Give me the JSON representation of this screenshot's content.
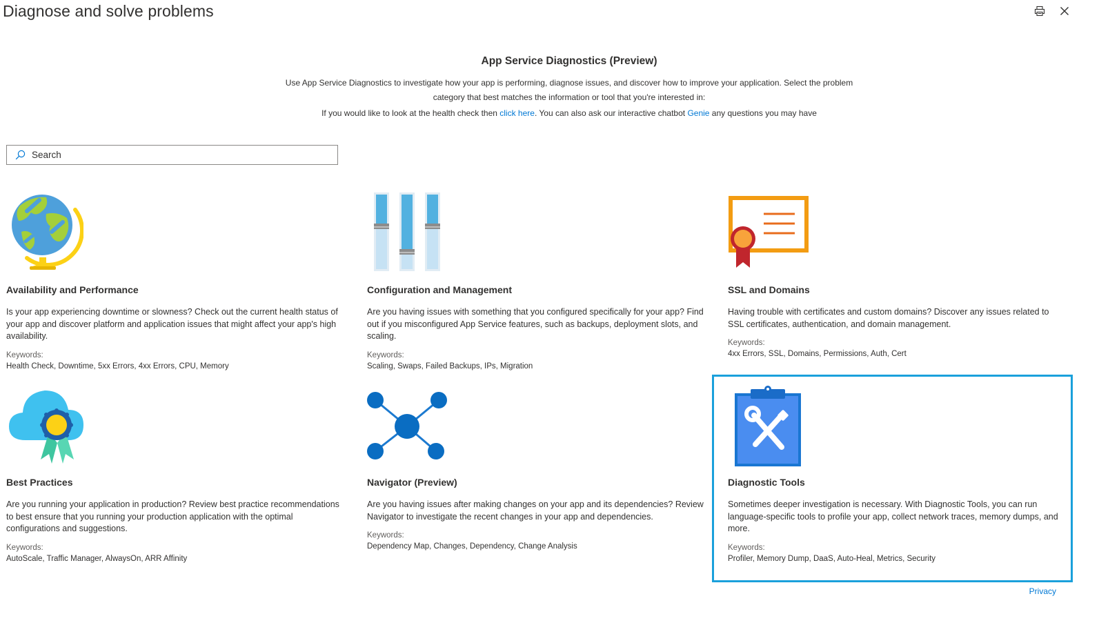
{
  "page": {
    "title": "Diagnose and solve problems"
  },
  "toolbar": {
    "print_icon": "print-icon",
    "close_icon": "close-icon"
  },
  "header": {
    "title": "App Service Diagnostics (Preview)",
    "description": "Use App Service Diagnostics to investigate how your app is performing, diagnose issues, and discover how to improve your application. Select the problem category that best matches the information or tool that you're interested in:",
    "health_prefix": "If you would like to look at the health check then ",
    "health_link": "click here",
    "health_middle": ". You can also ask our interactive chatbot ",
    "genie_link": "Genie",
    "health_suffix": " any questions you may have"
  },
  "search": {
    "placeholder": "Search",
    "value": ""
  },
  "cards": [
    {
      "title": "Availability and Performance",
      "description": "Is your app experiencing downtime or slowness? Check out the current health status of your app and discover platform and application issues that might affect your app's high availability.",
      "keywords_label": "Keywords:",
      "keywords": "Health Check, Downtime, 5xx Errors, 4xx Errors, CPU, Memory",
      "icon": "globe-icon"
    },
    {
      "title": "Configuration and Management",
      "description": "Are you having issues with something that you configured specifically for your app? Find out if you misconfigured App Service features, such as backups, deployment slots, and scaling.",
      "keywords_label": "Keywords:",
      "keywords": "Scaling, Swaps, Failed Backups, IPs, Migration",
      "icon": "sliders-icon"
    },
    {
      "title": "SSL and Domains",
      "description": "Having trouble with certificates and custom domains? Discover any issues related to SSL certificates, authentication, and domain management.",
      "keywords_label": "Keywords:",
      "keywords": "4xx Errors, SSL, Domains, Permissions, Auth, Cert",
      "icon": "certificate-icon"
    },
    {
      "title": "Best Practices",
      "description": "Are you running your application in production? Review best practice recommendations to best ensure that you running your production application with the optimal configurations and suggestions.",
      "keywords_label": "Keywords:",
      "keywords": "AutoScale, Traffic Manager, AlwaysOn, ARR Affinity",
      "icon": "cloud-badge-icon"
    },
    {
      "title": "Navigator (Preview)",
      "description": "Are you having issues after making changes on your app and its dependencies? Review Navigator to investigate the recent changes in your app and dependencies.",
      "keywords_label": "Keywords:",
      "keywords": "Dependency Map, Changes, Dependency, Change Analysis",
      "icon": "network-nodes-icon"
    },
    {
      "title": "Diagnostic Tools",
      "description": "Sometimes deeper investigation is necessary. With Diagnostic Tools, you can run language-specific tools to profile your app, collect network traces, memory dumps, and more.",
      "keywords_label": "Keywords:",
      "keywords": "Profiler, Memory Dump, DaaS, Auto-Heal, Metrics, Security",
      "icon": "clipboard-tools-icon",
      "selected": true
    }
  ],
  "footer": {
    "privacy_label": "Privacy"
  },
  "colors": {
    "accent": "#0078d4",
    "selection_border": "#1aa0db"
  }
}
